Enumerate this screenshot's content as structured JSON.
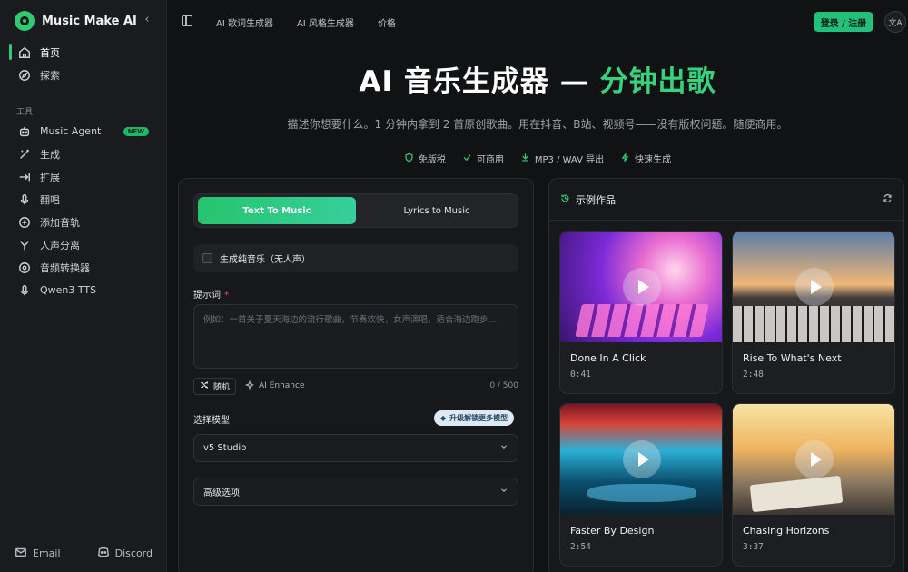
{
  "brand": {
    "name": "Music Make AI"
  },
  "sidebar": {
    "items_main": [
      {
        "label": "首页",
        "icon": "home-icon",
        "active": true
      },
      {
        "label": "探索",
        "icon": "compass-icon",
        "active": false
      }
    ],
    "section_label": "工具",
    "items_tools": [
      {
        "label": "Music Agent",
        "icon": "agent-icon",
        "badge": "NEW"
      },
      {
        "label": "生成",
        "icon": "magic-wand-icon"
      },
      {
        "label": "扩展",
        "icon": "extend-icon"
      },
      {
        "label": "翻唱",
        "icon": "microphone-icon"
      },
      {
        "label": "添加音轨",
        "icon": "add-track-icon"
      },
      {
        "label": "人声分离",
        "icon": "split-icon"
      },
      {
        "label": "音频转换器",
        "icon": "converter-icon"
      },
      {
        "label": "Qwen3 TTS",
        "icon": "mic-icon"
      }
    ],
    "footer": {
      "email": "Email",
      "discord": "Discord"
    }
  },
  "topbar": {
    "links": [
      "AI 歌词生成器",
      "AI 风格生成器",
      "价格"
    ],
    "login": "登录 / 注册",
    "lang": "文A"
  },
  "hero": {
    "title_main": "AI 音乐生成器 — ",
    "title_accent": "分钟出歌",
    "subtitle": "描述你想要什么。1 分钟内拿到 2 首原创歌曲。用在抖音、B站、视频号——没有版权问题。随便商用。",
    "features": [
      "免版税",
      "可商用",
      "MP3 / WAV 导出",
      "快速生成"
    ]
  },
  "generator": {
    "tabs": [
      "Text To Music",
      "Lyrics to Music"
    ],
    "instrumental_label": "生成纯音乐（无人声）",
    "prompt_label": "提示词",
    "prompt_required": "*",
    "prompt_placeholder": "例如：一首关于夏天海边的流行歌曲，节奏欢快，女声演唱，适合海边跑步...",
    "random_label": "随机",
    "enhance_label": "AI Enhance",
    "counter": "0 / 500",
    "model_label": "选择模型",
    "unlock_label": "升级解锁更多模型",
    "model_value": "v5 Studio",
    "advanced_label": "高级选项"
  },
  "examples": {
    "title": "示例作品",
    "cards": [
      {
        "title": "Done In A Click",
        "duration": "0:41"
      },
      {
        "title": "Rise To What's Next",
        "duration": "2:48"
      },
      {
        "title": "Faster By Design",
        "duration": "2:54"
      },
      {
        "title": "Chasing Horizons",
        "duration": "3:37"
      }
    ]
  },
  "colors": {
    "accent": "#2ecc71",
    "background": "#111214",
    "panel": "#17181b"
  }
}
